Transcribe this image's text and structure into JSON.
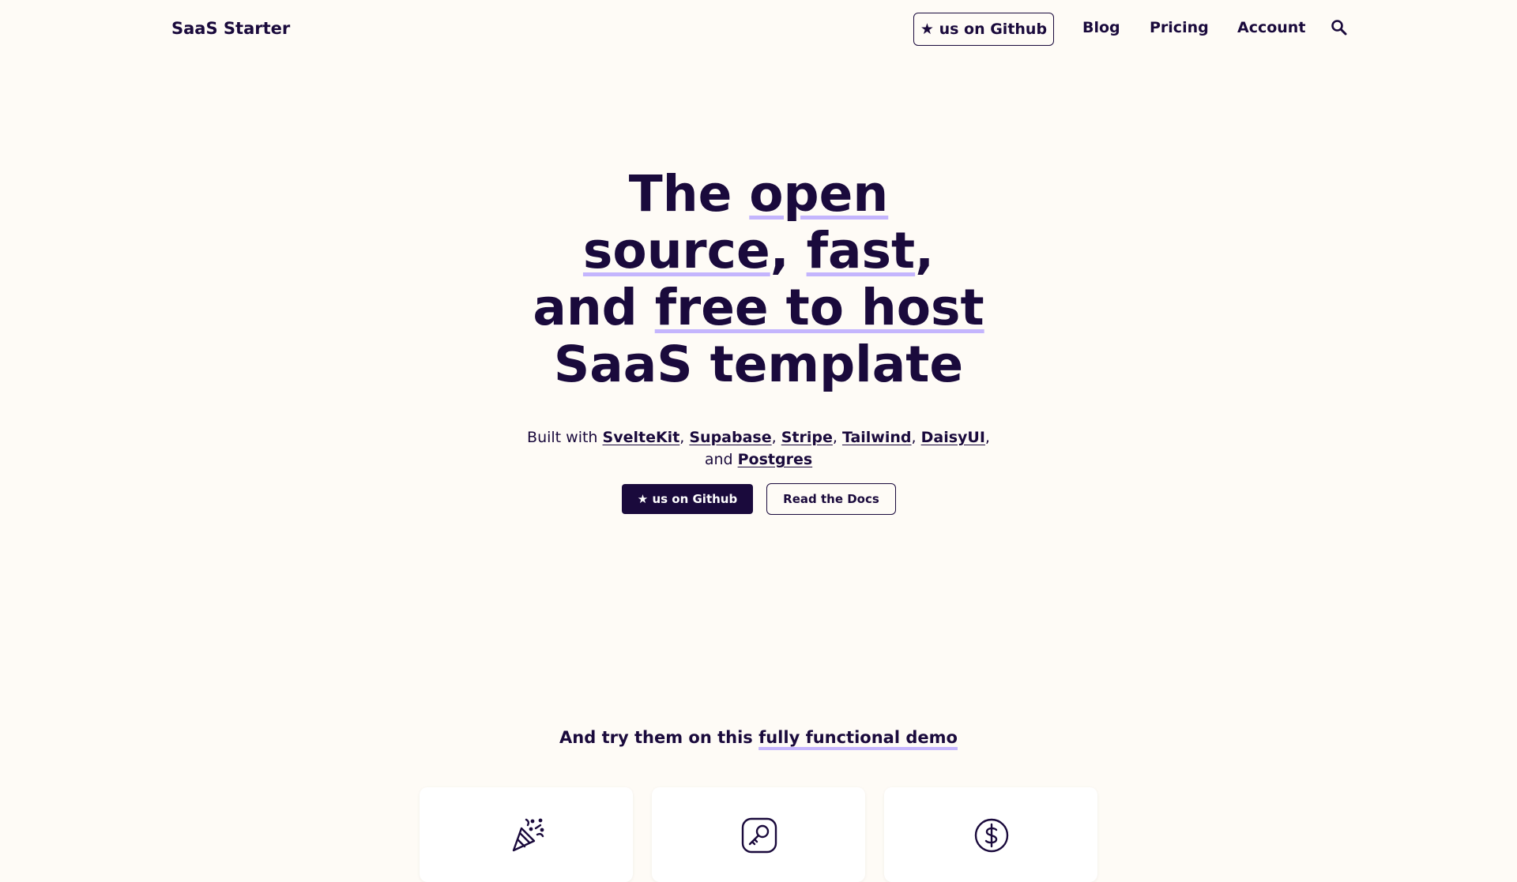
{
  "nav": {
    "brand": "SaaS Starter",
    "github_label": "★ us on Github",
    "links": [
      "Blog",
      "Pricing",
      "Account"
    ],
    "search_icon": "search-icon"
  },
  "hero": {
    "title_the": "The ",
    "title_open": "open",
    "title_source": "source",
    "title_comma1": ", ",
    "title_fast": "fast",
    "title_comma2": ",",
    "title_and": "and ",
    "title_free": "free to host",
    "title_saas": "SaaS template",
    "sub_prefix": "Built with ",
    "tech": [
      "SvelteKit",
      "Supabase",
      "Stripe",
      "Tailwind",
      "DaisyUI"
    ],
    "sub_and": "and ",
    "last_tech": "Postgres",
    "btn_github": "★ us on Github",
    "btn_docs": "Read the Docs"
  },
  "demo": {
    "prefix": "And try them on this ",
    "link": "fully functional demo"
  },
  "cards": [
    {
      "icon": "party-popper-icon"
    },
    {
      "icon": "key-icon"
    },
    {
      "icon": "dollar-circle-icon"
    }
  ],
  "colors": {
    "background": "#fefbf6",
    "primary": "#1a0a3c",
    "highlight": "#c4b5fd"
  }
}
